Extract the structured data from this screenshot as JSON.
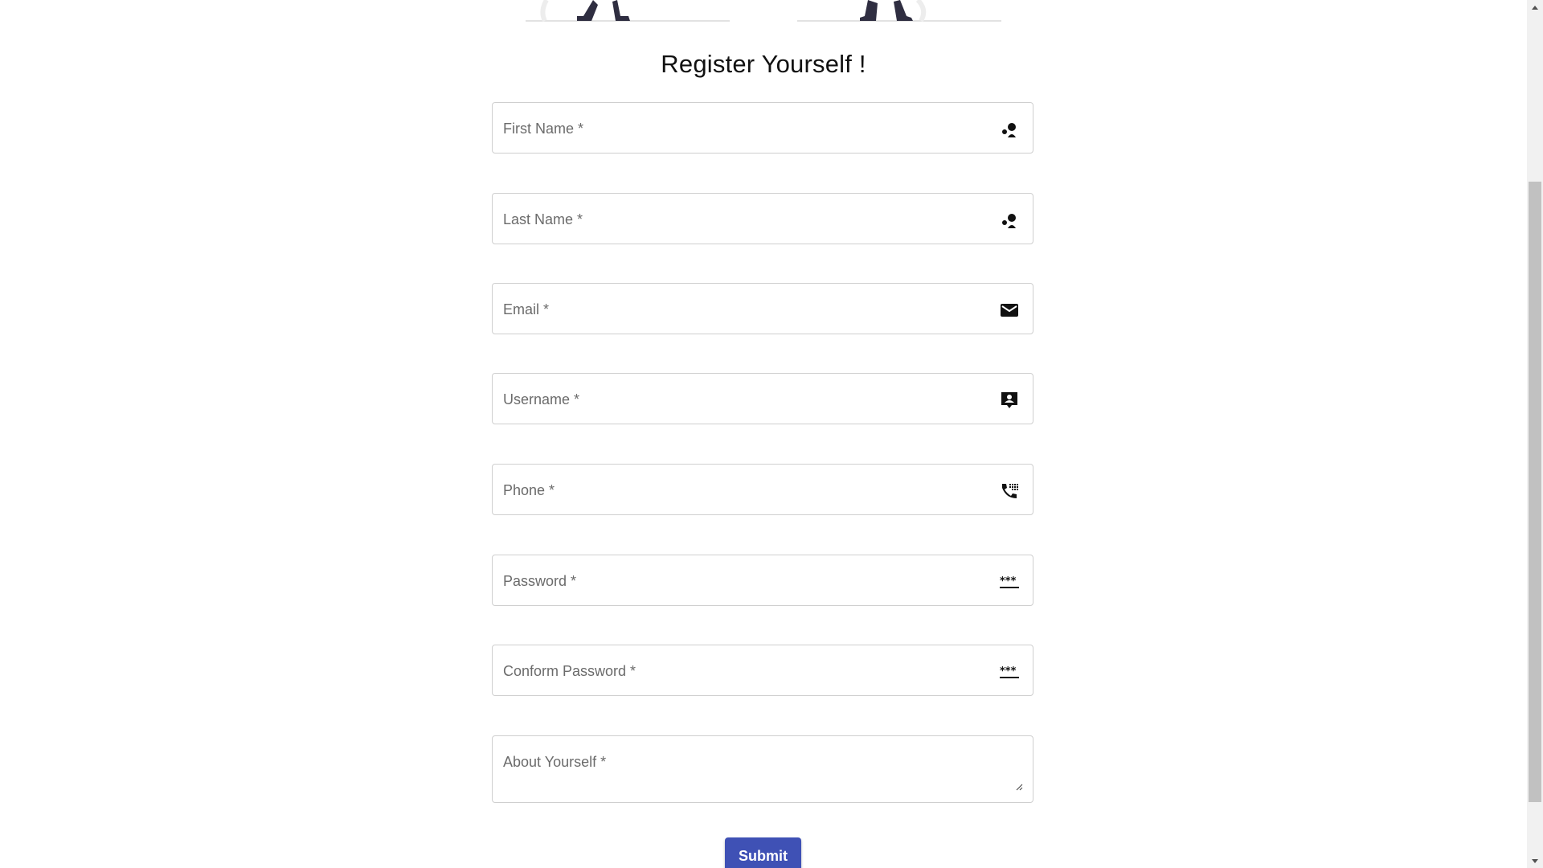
{
  "form": {
    "title": "Register Yourself !",
    "fields": [
      {
        "label": "First Name *",
        "icon": "person-group-icon"
      },
      {
        "label": "Last Name *",
        "icon": "person-group-icon"
      },
      {
        "label": "Email *",
        "icon": "mail-icon"
      },
      {
        "label": "Username *",
        "icon": "contact-card-icon"
      },
      {
        "label": "Phone *",
        "icon": "dialpad-phone-icon"
      },
      {
        "label": "Password *",
        "icon": "password-icon"
      },
      {
        "label": "Conform Password *",
        "icon": "password-icon"
      },
      {
        "label": "About Yourself *",
        "icon": "resize-handle-icon"
      }
    ],
    "submit_label": "Submit"
  },
  "colors": {
    "primary": "#3f51b5",
    "label": "#6b6b6b",
    "border": "#cfcfcf"
  }
}
